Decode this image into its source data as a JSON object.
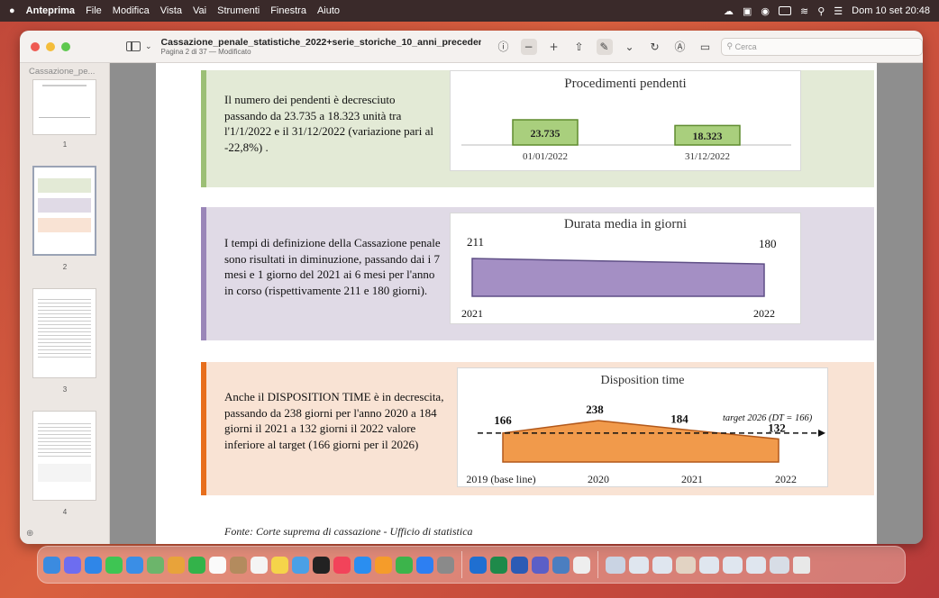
{
  "menubar": {
    "app_name": "Anteprima",
    "menus": [
      "File",
      "Modifica",
      "Vista",
      "Vai",
      "Strumenti",
      "Finestra",
      "Aiuto"
    ],
    "clock": "Dom 10 set  20:48"
  },
  "window": {
    "doc_title": "Cassazione_penale_statistiche_2022+serie_storiche_10_anni_precedenti....",
    "doc_subtitle": "Pagina 2 di 37 — Modificato",
    "search_placeholder": "Cerca"
  },
  "sidebar": {
    "title": "Cassazione_pe...",
    "pages": [
      "1",
      "2",
      "3",
      "4"
    ]
  },
  "page": {
    "panel1_text": "Il numero dei pendenti è decresciuto passando da  23.735 a 18.323 unità tra l'1/1/2022 e il 31/12/2022 (variazione pari al -22,8%) .",
    "panel2_text": "I tempi di definizione della Cassazione penale sono risultati in diminuzione, passando dai i 7 mesi e 1 giorno del 2021 ai 6 mesi per l'anno in corso (rispettivamente 211 e 180 giorni).",
    "panel3_text": "Anche il DISPOSITION TIME è in decrescita, passando da 238 giorni per l'anno 2020 a 184 giorni il 2021 a 132 giorni il 2022 valore inferiore al target (166 giorni per il 2026)",
    "source": "Fonte: Corte suprema di cassazione - Ufficio di statistica"
  },
  "chart_data": [
    {
      "type": "bar",
      "title": "Procedimenti pendenti",
      "categories": [
        "01/01/2022",
        "31/12/2022"
      ],
      "values": [
        23735,
        18323
      ],
      "value_labels": [
        "23.735",
        "18.323"
      ],
      "bar_color": "#a9cf7d",
      "bar_border": "#5f8b2f"
    },
    {
      "type": "area",
      "title": "Durata media in giorni",
      "categories": [
        "2021",
        "2022"
      ],
      "values": [
        211,
        180
      ],
      "value_labels": [
        "211",
        "180"
      ],
      "fill_color": "#a48fc4",
      "line_color": "#5f4f86"
    },
    {
      "type": "area",
      "title": "Disposition time",
      "categories": [
        "2019 (base line)",
        "2020",
        "2021",
        "2022"
      ],
      "values": [
        166,
        238,
        184,
        132
      ],
      "value_labels": [
        "166",
        "238",
        "184",
        "132"
      ],
      "target_value": 166,
      "target_label": "target 2026 (DT = 166)",
      "fill_color": "#f19a4b",
      "line_color": "#b2581a"
    }
  ]
}
